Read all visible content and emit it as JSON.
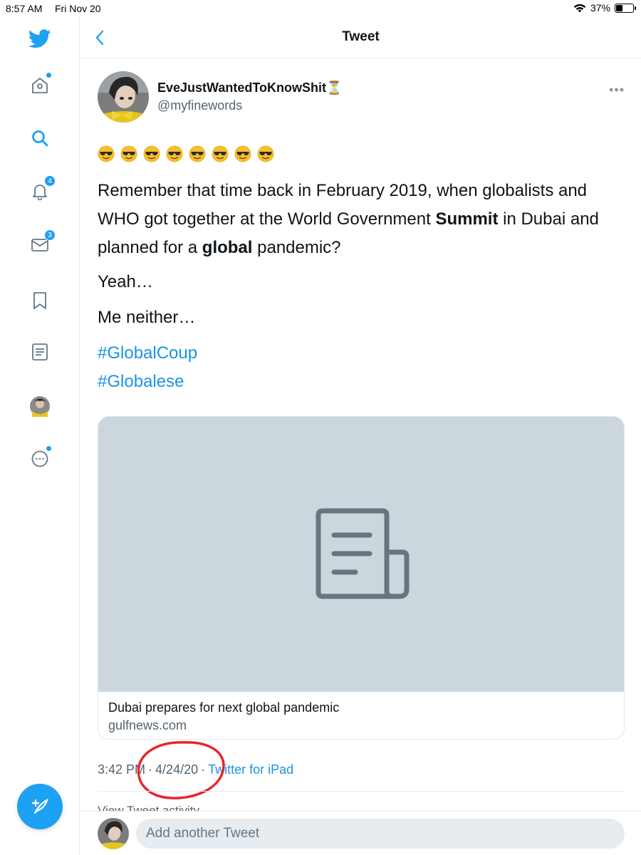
{
  "status_bar": {
    "time": "8:57 AM",
    "date": "Fri Nov 20",
    "battery": "37%",
    "battery_level": 0.37
  },
  "sidebar": {
    "items": [
      {
        "icon": "home-icon",
        "has_dot": true
      },
      {
        "icon": "search-icon"
      },
      {
        "icon": "bell-icon",
        "badge": "4"
      },
      {
        "icon": "mail-icon",
        "badge": "3"
      },
      {
        "icon": "bookmark-icon"
      },
      {
        "icon": "lists-icon"
      },
      {
        "icon": "profile-avatar"
      },
      {
        "icon": "more-circle-icon",
        "has_dot": true
      }
    ],
    "compose_icon": "compose-feather-icon"
  },
  "header": {
    "title": "Tweet",
    "back_icon": "chevron-left-icon"
  },
  "tweet": {
    "display_name": "EveJustWantedToKnowShit",
    "name_emoji": "⏳",
    "handle": "@myfinewords",
    "emoji_row": "😎😎😎😎😎😎😎😎",
    "para1_a": "Remember that time back in February 2019, when globalists and WHO got together at the World Government ",
    "para1_b": "Summit",
    "para1_c": " in Dubai and planned for a ",
    "para1_d": "global",
    "para1_e": " pandemic?",
    "para2": "Yeah…",
    "para3": "Me neither…",
    "hashtags": [
      "#GlobalCoup",
      "#Globalese"
    ],
    "card": {
      "title": "Dubai prepares for next global pandemic",
      "domain": "gulfnews.com"
    },
    "time": "3:42 PM",
    "date": "4/24/20",
    "separator": "·",
    "source": "Twitter for iPad",
    "activity": "View Tweet activity"
  },
  "reply": {
    "placeholder": "Add another Tweet"
  },
  "colors": {
    "accent": "#1da1f2",
    "link": "#1b95e0",
    "annotation_red": "#e8252d",
    "card_bg": "#ccd6dd"
  }
}
